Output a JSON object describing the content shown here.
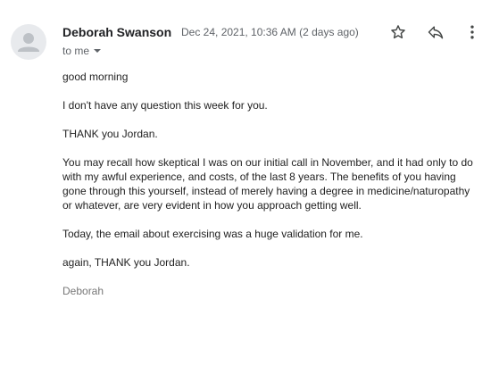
{
  "email": {
    "sender_name": "Deborah Swanson",
    "date": "Dec 24, 2021, 10:36 AM (2 days ago)",
    "recipient": "to me",
    "icons": {
      "avatar": "person-avatar-icon",
      "star": "star-outline-icon",
      "reply": "reply-icon",
      "more": "more-vertical-icon"
    },
    "paragraphs": [
      "good morning",
      "I don't have any question this week for you.",
      "THANK you Jordan.",
      "You may recall how skeptical I was on our initial call in November, and it had only to do with my awful experience, and costs, of the last 8 years.   The benefits of you having gone through this yourself, instead of merely having a degree in medicine/naturopathy or whatever, are very evident in how you approach getting well.",
      "Today, the email about exercising was a huge validation for me.",
      "again, THANK you Jordan."
    ],
    "signature": "Deborah"
  },
  "colors": {
    "icon": "#444746",
    "meta_text": "#5f6368",
    "avatar_bg": "#e8eaed",
    "avatar_fg": "#bdc1c6"
  }
}
